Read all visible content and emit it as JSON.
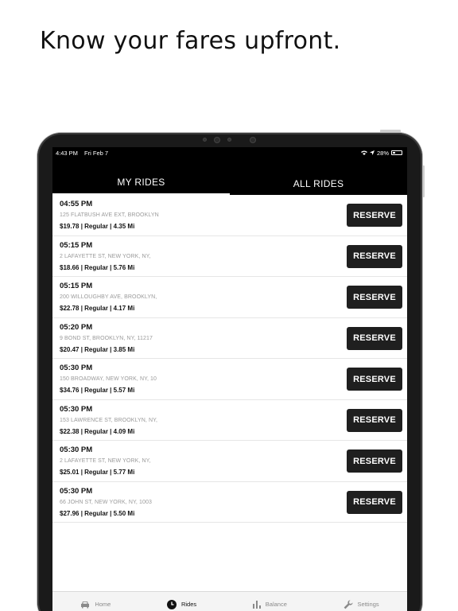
{
  "headline": "Know your fares upfront.",
  "status_bar": {
    "time": "4:43 PM",
    "date": "Fri Feb 7",
    "battery": "28%"
  },
  "tabs": [
    {
      "label": "MY RIDES",
      "active": true
    },
    {
      "label": "ALL RIDES",
      "active": false
    }
  ],
  "reserve_label": "RESERVE",
  "rides": [
    {
      "time": "04:55 PM",
      "address": "125 FLATBUSH AVE EXT, BROOKLYN",
      "fare": "$19.78 | Regular | 4.35 Mi"
    },
    {
      "time": "05:15 PM",
      "address": "2 LAFAYETTE ST, NEW YORK, NY,",
      "fare": "$18.66 | Regular | 5.76 Mi"
    },
    {
      "time": "05:15 PM",
      "address": "200 WILLOUGHBY AVE, BROOKLYN,",
      "fare": "$22.78 | Regular | 4.17 Mi"
    },
    {
      "time": "05:20 PM",
      "address": "9 BOND ST, BROOKLYN, NY, 11217",
      "fare": "$20.47 | Regular | 3.85 Mi"
    },
    {
      "time": "05:30 PM",
      "address": "150 BROADWAY, NEW YORK, NY, 10",
      "fare": "$34.76 | Regular | 5.57 Mi"
    },
    {
      "time": "05:30 PM",
      "address": "153 LAWRENCE ST, BROOKLYN, NY,",
      "fare": "$22.38 | Regular | 4.09 Mi"
    },
    {
      "time": "05:30 PM",
      "address": "2 LAFAYETTE ST, NEW YORK, NY,",
      "fare": "$25.01 | Regular | 5.77 Mi"
    },
    {
      "time": "05:30 PM",
      "address": "66 JOHN ST, NEW YORK, NY, 1003",
      "fare": "$27.96 | Regular | 5.50 Mi"
    }
  ],
  "bottom_nav": [
    {
      "label": "Home",
      "icon": "car-icon",
      "active": false
    },
    {
      "label": "Rides",
      "icon": "clock-icon",
      "active": true
    },
    {
      "label": "Balance",
      "icon": "bar-chart-icon",
      "active": false
    },
    {
      "label": "Settings",
      "icon": "wrench-icon",
      "active": false
    }
  ]
}
